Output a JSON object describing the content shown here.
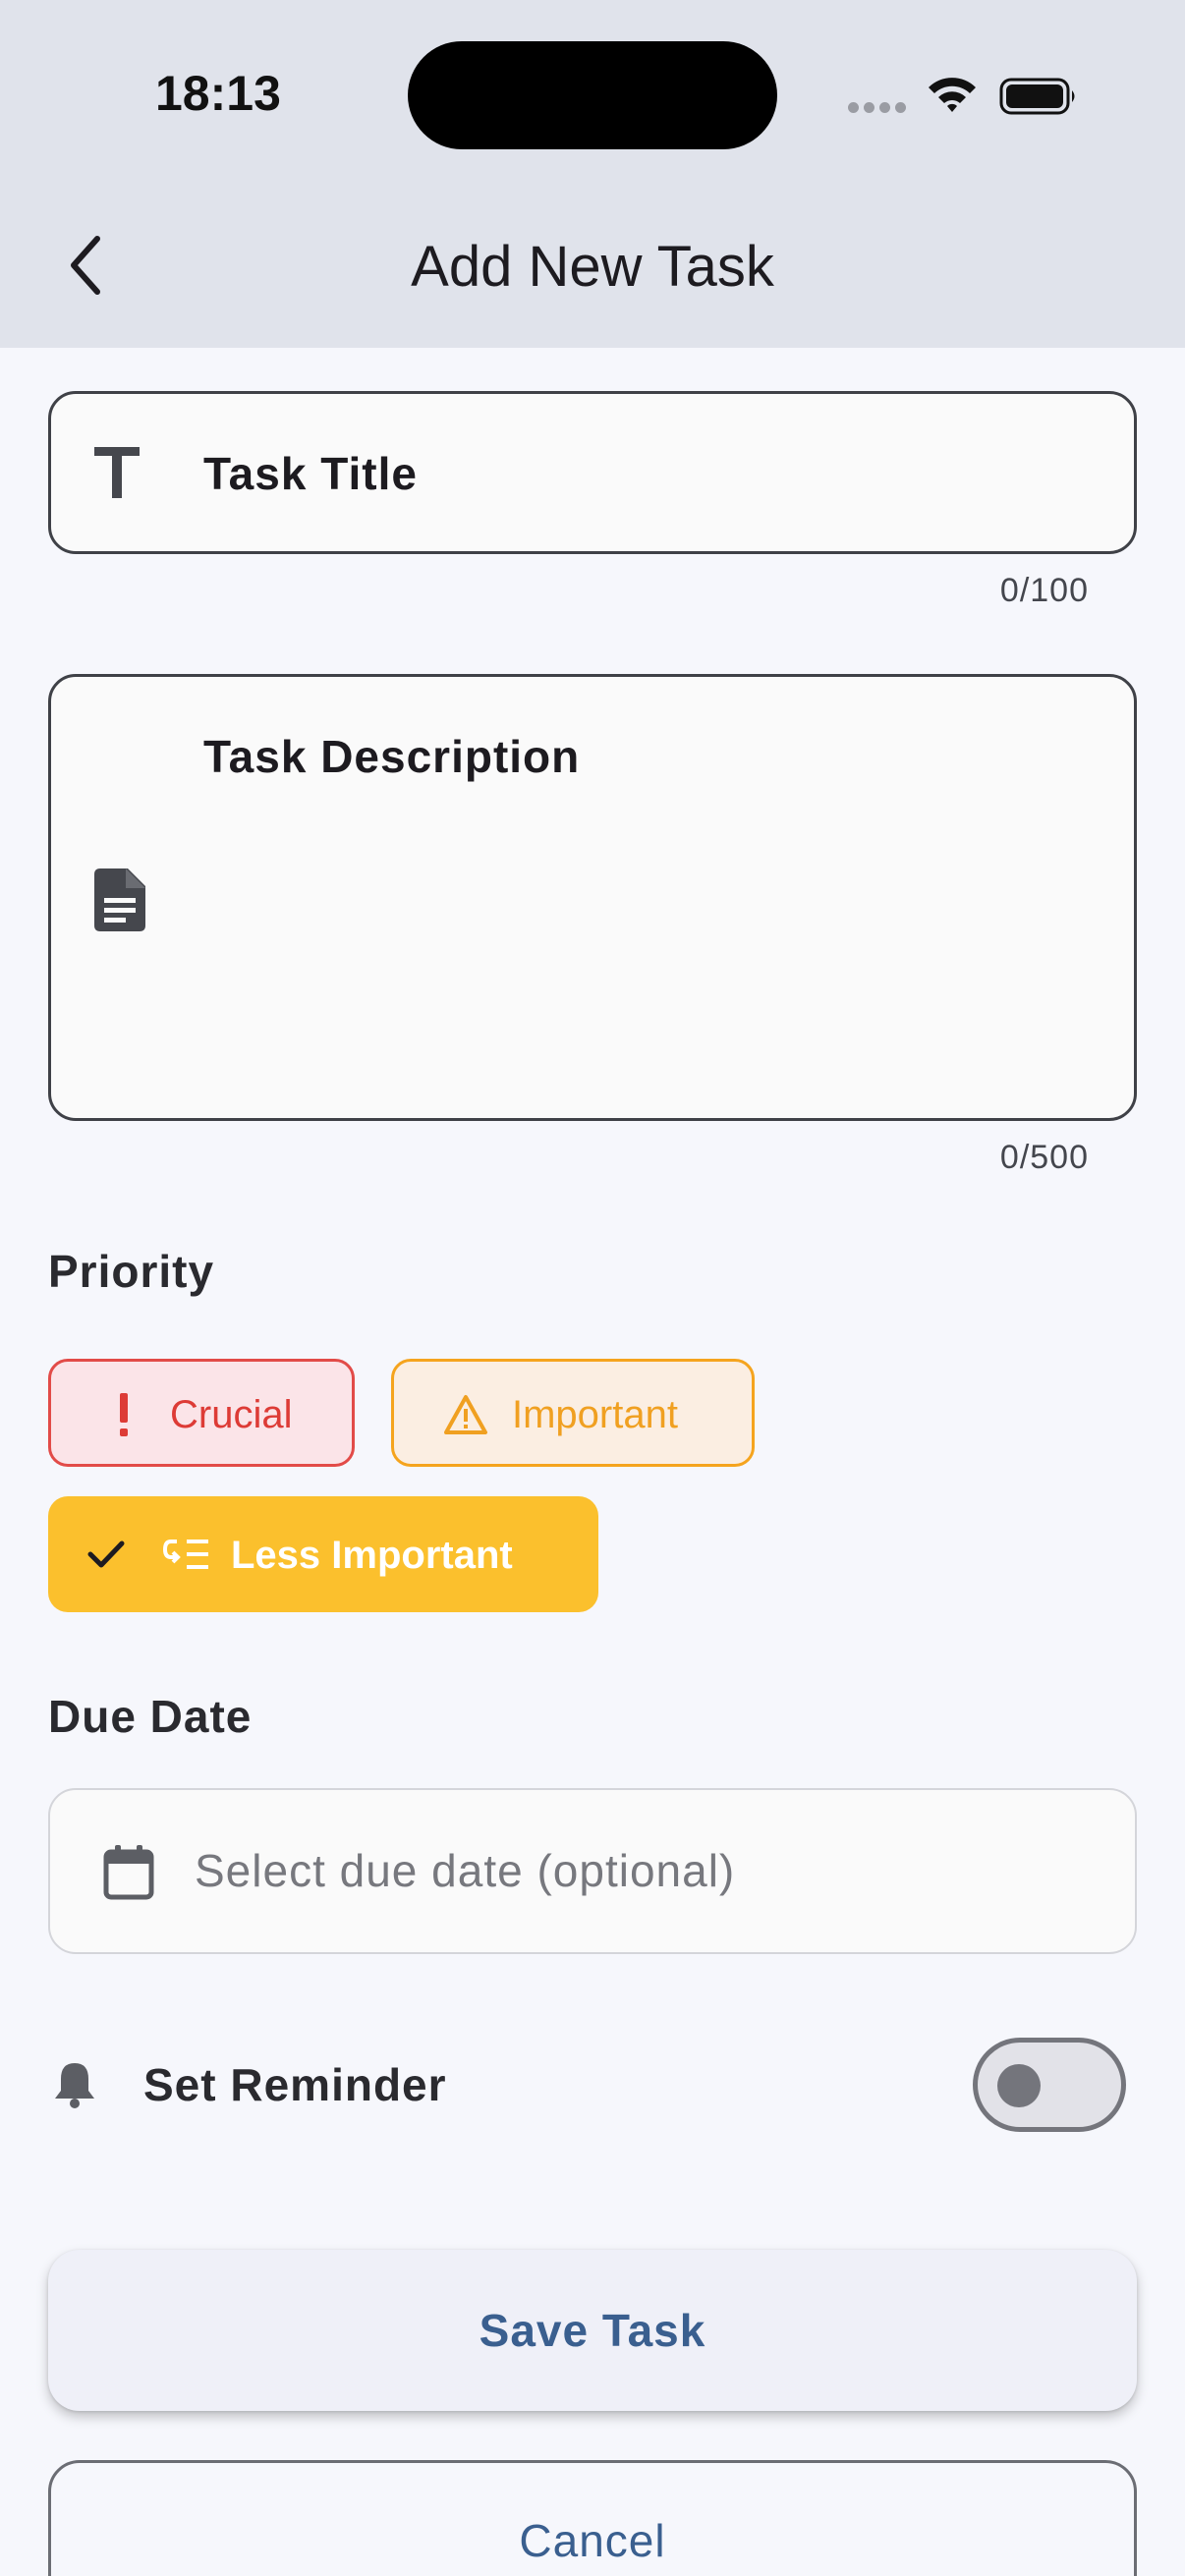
{
  "status_bar": {
    "time": "18:13"
  },
  "app_bar": {
    "title": "Add New Task",
    "back_icon": "chevron-left-icon"
  },
  "title_field": {
    "label": "Task Title",
    "counter": "0/100",
    "icon": "text-t-icon"
  },
  "description_field": {
    "label": "Task Description",
    "counter": "0/500",
    "icon": "document-icon"
  },
  "priority": {
    "label": "Priority",
    "options": [
      {
        "label": "Crucial",
        "icon": "exclamation-icon",
        "selected": false,
        "color": "#dd3b36"
      },
      {
        "label": "Important",
        "icon": "warning-triangle-icon",
        "selected": false,
        "color": "#f0a021"
      },
      {
        "label": "Less Important",
        "icon": "low-priority-icon",
        "selected": true,
        "color": "#fbc02d"
      }
    ]
  },
  "due_date": {
    "label": "Due Date",
    "placeholder": "Select due date (optional)",
    "icon": "calendar-icon"
  },
  "reminder": {
    "label": "Set Reminder",
    "enabled": false,
    "icon": "bell-icon"
  },
  "actions": {
    "save_label": "Save Task",
    "cancel_label": "Cancel"
  }
}
